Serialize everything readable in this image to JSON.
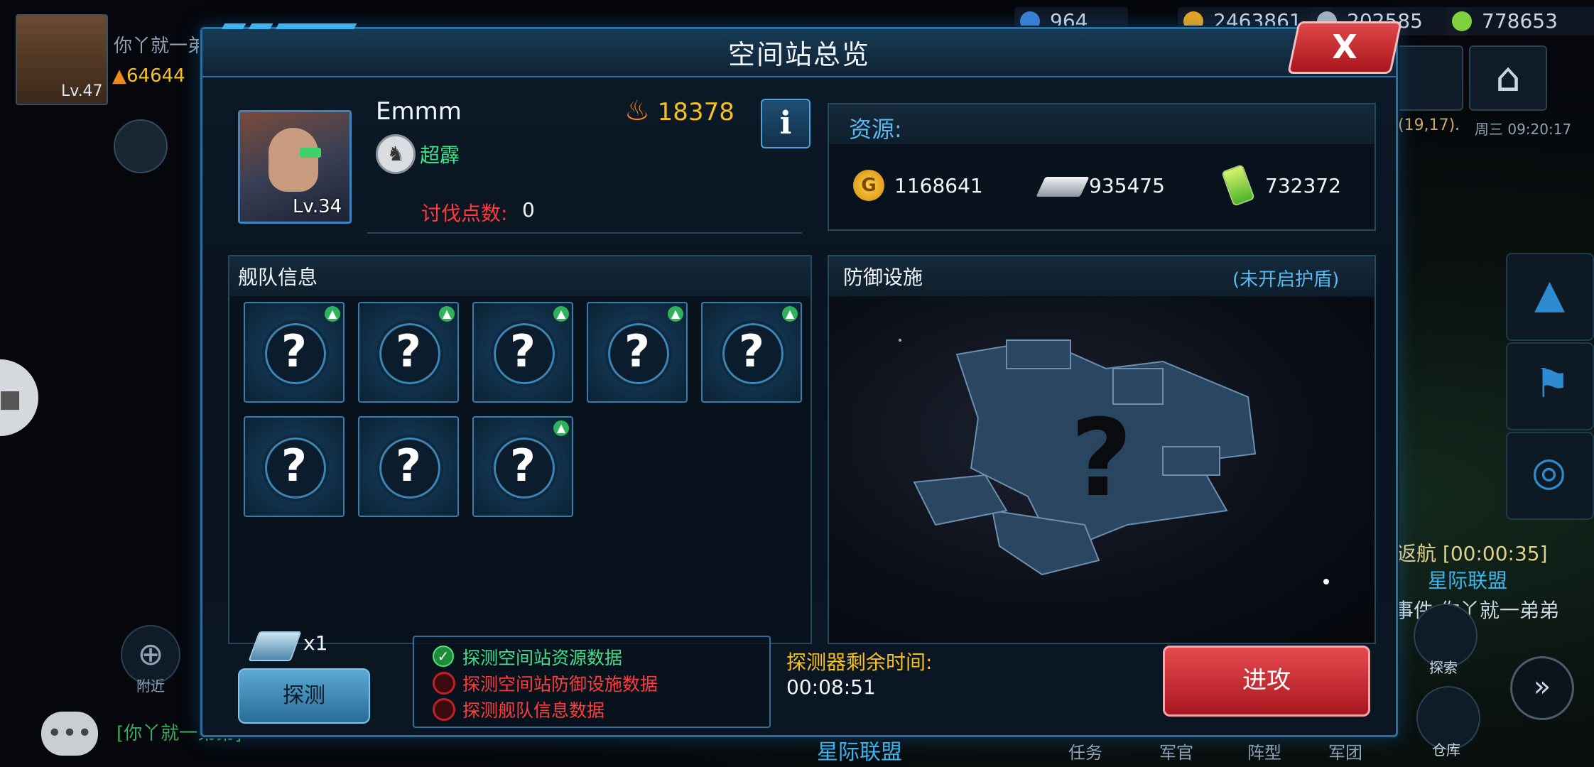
{
  "background": {
    "player": {
      "name": "你丫就一弟弟",
      "level": "Lv.47",
      "power": "64644"
    },
    "top_resources": [
      {
        "icon": "diamond-icon",
        "value": "964"
      },
      {
        "icon": "gold-coin-icon",
        "value": "2463861"
      },
      {
        "icon": "metal-icon",
        "value": "202585"
      },
      {
        "icon": "energy-icon",
        "value": "778653"
      }
    ],
    "coords": "(19,17)",
    "clock": "周三 09:20:17",
    "return_status": "返航 [00:00:35]",
    "alliance_name": "星际联盟",
    "event_text": "事件 你丫就一弟弟",
    "chat_text": "[你丫就一弟弟]",
    "nearby_label": "附近",
    "explore_label": "探索",
    "warehouse_label": "仓库",
    "bottom_nav": [
      "任务",
      "军官",
      "阵型",
      "军团"
    ],
    "bottom_alliance": "星际联盟"
  },
  "panel": {
    "title": "空间站总览",
    "close_label": "X",
    "profile": {
      "name": "Emmm",
      "level": "Lv.34",
      "guild": "超霹",
      "power": "18378",
      "attack_points_label": "讨伐点数:",
      "attack_points_value": "0",
      "info_label": "i"
    },
    "resources": {
      "label": "资源:",
      "gold": "1168641",
      "metal": "935475",
      "energy": "732372"
    },
    "fleet": {
      "label": "舰队信息",
      "cards": [
        {
          "symbol": "?",
          "badge": true
        },
        {
          "symbol": "?",
          "badge": true
        },
        {
          "symbol": "?",
          "badge": true
        },
        {
          "symbol": "?",
          "badge": true
        },
        {
          "symbol": "?",
          "badge": true
        },
        {
          "symbol": "?",
          "badge": false
        },
        {
          "symbol": "?",
          "badge": false
        },
        {
          "symbol": "?",
          "badge": true
        }
      ]
    },
    "defense": {
      "label": "防御设施",
      "shield_status": "(未开启护盾)",
      "unknown_symbol": "?"
    },
    "probe": {
      "count": "x1",
      "button_label": "探测",
      "checklist": [
        {
          "text": "探测空间站资源数据",
          "done": true
        },
        {
          "text": "探测空间站防御设施数据",
          "done": false
        },
        {
          "text": "探测舰队信息数据",
          "done": false
        }
      ],
      "timer_label": "探测器剩余时间:",
      "timer_value": "00:08:51"
    },
    "attack_label": "进攻"
  },
  "colors": {
    "accent_blue": "#2c6f9e",
    "gold_text": "#f5c022",
    "green_text": "#3fe08a",
    "red_text": "#ff3b3b",
    "attack_button": "#c8262d"
  }
}
